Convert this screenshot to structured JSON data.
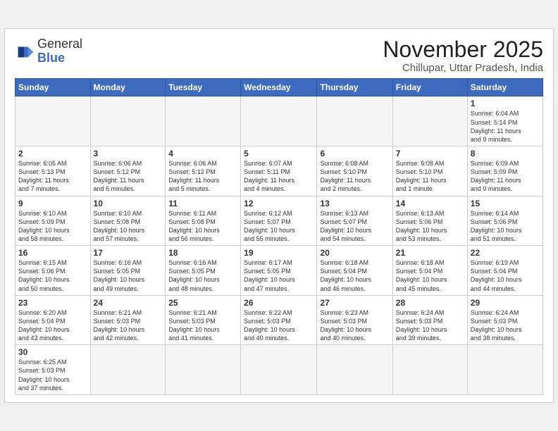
{
  "header": {
    "logo_general": "General",
    "logo_blue": "Blue",
    "title": "November 2025",
    "location": "Chillupar, Uttar Pradesh, India"
  },
  "weekdays": [
    "Sunday",
    "Monday",
    "Tuesday",
    "Wednesday",
    "Thursday",
    "Friday",
    "Saturday"
  ],
  "weeks": [
    [
      {
        "day": "",
        "info": ""
      },
      {
        "day": "",
        "info": ""
      },
      {
        "day": "",
        "info": ""
      },
      {
        "day": "",
        "info": ""
      },
      {
        "day": "",
        "info": ""
      },
      {
        "day": "",
        "info": ""
      },
      {
        "day": "1",
        "info": "Sunrise: 6:04 AM\nSunset: 5:14 PM\nDaylight: 11 hours\nand 9 minutes."
      }
    ],
    [
      {
        "day": "2",
        "info": "Sunrise: 6:05 AM\nSunset: 5:13 PM\nDaylight: 11 hours\nand 7 minutes."
      },
      {
        "day": "3",
        "info": "Sunrise: 6:06 AM\nSunset: 5:12 PM\nDaylight: 11 hours\nand 6 minutes."
      },
      {
        "day": "4",
        "info": "Sunrise: 6:06 AM\nSunset: 5:12 PM\nDaylight: 11 hours\nand 5 minutes."
      },
      {
        "day": "5",
        "info": "Sunrise: 6:07 AM\nSunset: 5:11 PM\nDaylight: 11 hours\nand 4 minutes."
      },
      {
        "day": "6",
        "info": "Sunrise: 6:08 AM\nSunset: 5:10 PM\nDaylight: 11 hours\nand 2 minutes."
      },
      {
        "day": "7",
        "info": "Sunrise: 6:08 AM\nSunset: 5:10 PM\nDaylight: 11 hours\nand 1 minute."
      },
      {
        "day": "8",
        "info": "Sunrise: 6:09 AM\nSunset: 5:09 PM\nDaylight: 11 hours\nand 0 minutes."
      }
    ],
    [
      {
        "day": "9",
        "info": "Sunrise: 6:10 AM\nSunset: 5:09 PM\nDaylight: 10 hours\nand 58 minutes."
      },
      {
        "day": "10",
        "info": "Sunrise: 6:10 AM\nSunset: 5:08 PM\nDaylight: 10 hours\nand 57 minutes."
      },
      {
        "day": "11",
        "info": "Sunrise: 6:11 AM\nSunset: 5:08 PM\nDaylight: 10 hours\nand 56 minutes."
      },
      {
        "day": "12",
        "info": "Sunrise: 6:12 AM\nSunset: 5:07 PM\nDaylight: 10 hours\nand 55 minutes."
      },
      {
        "day": "13",
        "info": "Sunrise: 6:13 AM\nSunset: 5:07 PM\nDaylight: 10 hours\nand 54 minutes."
      },
      {
        "day": "14",
        "info": "Sunrise: 6:13 AM\nSunset: 5:06 PM\nDaylight: 10 hours\nand 53 minutes."
      },
      {
        "day": "15",
        "info": "Sunrise: 6:14 AM\nSunset: 5:06 PM\nDaylight: 10 hours\nand 51 minutes."
      }
    ],
    [
      {
        "day": "16",
        "info": "Sunrise: 6:15 AM\nSunset: 5:06 PM\nDaylight: 10 hours\nand 50 minutes."
      },
      {
        "day": "17",
        "info": "Sunrise: 6:16 AM\nSunset: 5:05 PM\nDaylight: 10 hours\nand 49 minutes."
      },
      {
        "day": "18",
        "info": "Sunrise: 6:16 AM\nSunset: 5:05 PM\nDaylight: 10 hours\nand 48 minutes."
      },
      {
        "day": "19",
        "info": "Sunrise: 6:17 AM\nSunset: 5:05 PM\nDaylight: 10 hours\nand 47 minutes."
      },
      {
        "day": "20",
        "info": "Sunrise: 6:18 AM\nSunset: 5:04 PM\nDaylight: 10 hours\nand 46 minutes."
      },
      {
        "day": "21",
        "info": "Sunrise: 6:18 AM\nSunset: 5:04 PM\nDaylight: 10 hours\nand 45 minutes."
      },
      {
        "day": "22",
        "info": "Sunrise: 6:19 AM\nSunset: 5:04 PM\nDaylight: 10 hours\nand 44 minutes."
      }
    ],
    [
      {
        "day": "23",
        "info": "Sunrise: 6:20 AM\nSunset: 5:04 PM\nDaylight: 10 hours\nand 43 minutes."
      },
      {
        "day": "24",
        "info": "Sunrise: 6:21 AM\nSunset: 5:03 PM\nDaylight: 10 hours\nand 42 minutes."
      },
      {
        "day": "25",
        "info": "Sunrise: 6:21 AM\nSunset: 5:03 PM\nDaylight: 10 hours\nand 41 minutes."
      },
      {
        "day": "26",
        "info": "Sunrise: 6:22 AM\nSunset: 5:03 PM\nDaylight: 10 hours\nand 40 minutes."
      },
      {
        "day": "27",
        "info": "Sunrise: 6:23 AM\nSunset: 5:03 PM\nDaylight: 10 hours\nand 40 minutes."
      },
      {
        "day": "28",
        "info": "Sunrise: 6:24 AM\nSunset: 5:03 PM\nDaylight: 10 hours\nand 39 minutes."
      },
      {
        "day": "29",
        "info": "Sunrise: 6:24 AM\nSunset: 5:03 PM\nDaylight: 10 hours\nand 38 minutes."
      }
    ],
    [
      {
        "day": "30",
        "info": "Sunrise: 6:25 AM\nSunset: 5:03 PM\nDaylight: 10 hours\nand 37 minutes."
      },
      {
        "day": "",
        "info": ""
      },
      {
        "day": "",
        "info": ""
      },
      {
        "day": "",
        "info": ""
      },
      {
        "day": "",
        "info": ""
      },
      {
        "day": "",
        "info": ""
      },
      {
        "day": "",
        "info": ""
      }
    ]
  ]
}
